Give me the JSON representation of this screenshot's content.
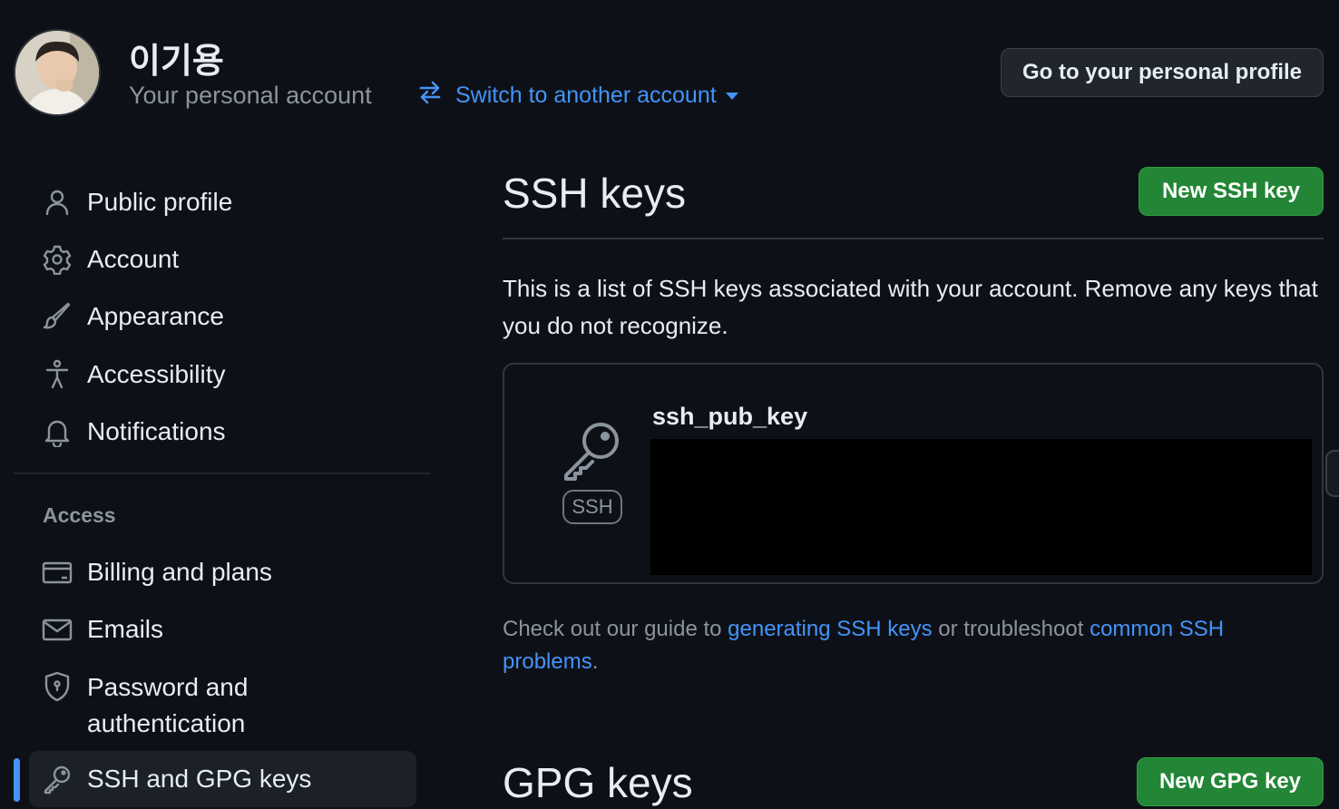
{
  "header": {
    "user_name": "이기용",
    "account_type": "Your personal account",
    "switch_account_label": "Switch to another account",
    "profile_button_label": "Go to your personal profile"
  },
  "sidebar": {
    "items": [
      {
        "label": "Public profile",
        "icon": "person-icon"
      },
      {
        "label": "Account",
        "icon": "gear-icon"
      },
      {
        "label": "Appearance",
        "icon": "paintbrush-icon"
      },
      {
        "label": "Accessibility",
        "icon": "accessibility-icon"
      },
      {
        "label": "Notifications",
        "icon": "bell-icon"
      }
    ],
    "access_heading": "Access",
    "access_items": [
      {
        "label": "Billing and plans",
        "icon": "credit-card-icon"
      },
      {
        "label": "Emails",
        "icon": "mail-icon"
      },
      {
        "label": "Password and",
        "label_line2": "authentication",
        "icon": "shield-lock-icon"
      },
      {
        "label": "SSH and GPG keys",
        "icon": "key-icon",
        "selected": true
      }
    ]
  },
  "ssh": {
    "title": "SSH keys",
    "new_button_label": "New SSH key",
    "description": "This is a list of SSH keys associated with your account. Remove any keys that you do not recognize.",
    "keys": [
      {
        "title": "ssh_pub_key",
        "badge": "SSH"
      }
    ],
    "guide_prefix": "Check out our guide to ",
    "guide_link1": "generating SSH keys",
    "guide_middle": " or troubleshoot ",
    "guide_link2": "common SSH problems",
    "guide_suffix": "."
  },
  "gpg": {
    "title": "GPG keys",
    "new_button_label": "New GPG key"
  },
  "colors": {
    "background": "#0d1117",
    "link": "#4493f8",
    "primary_button": "#238636",
    "muted_text": "#8b949e"
  }
}
